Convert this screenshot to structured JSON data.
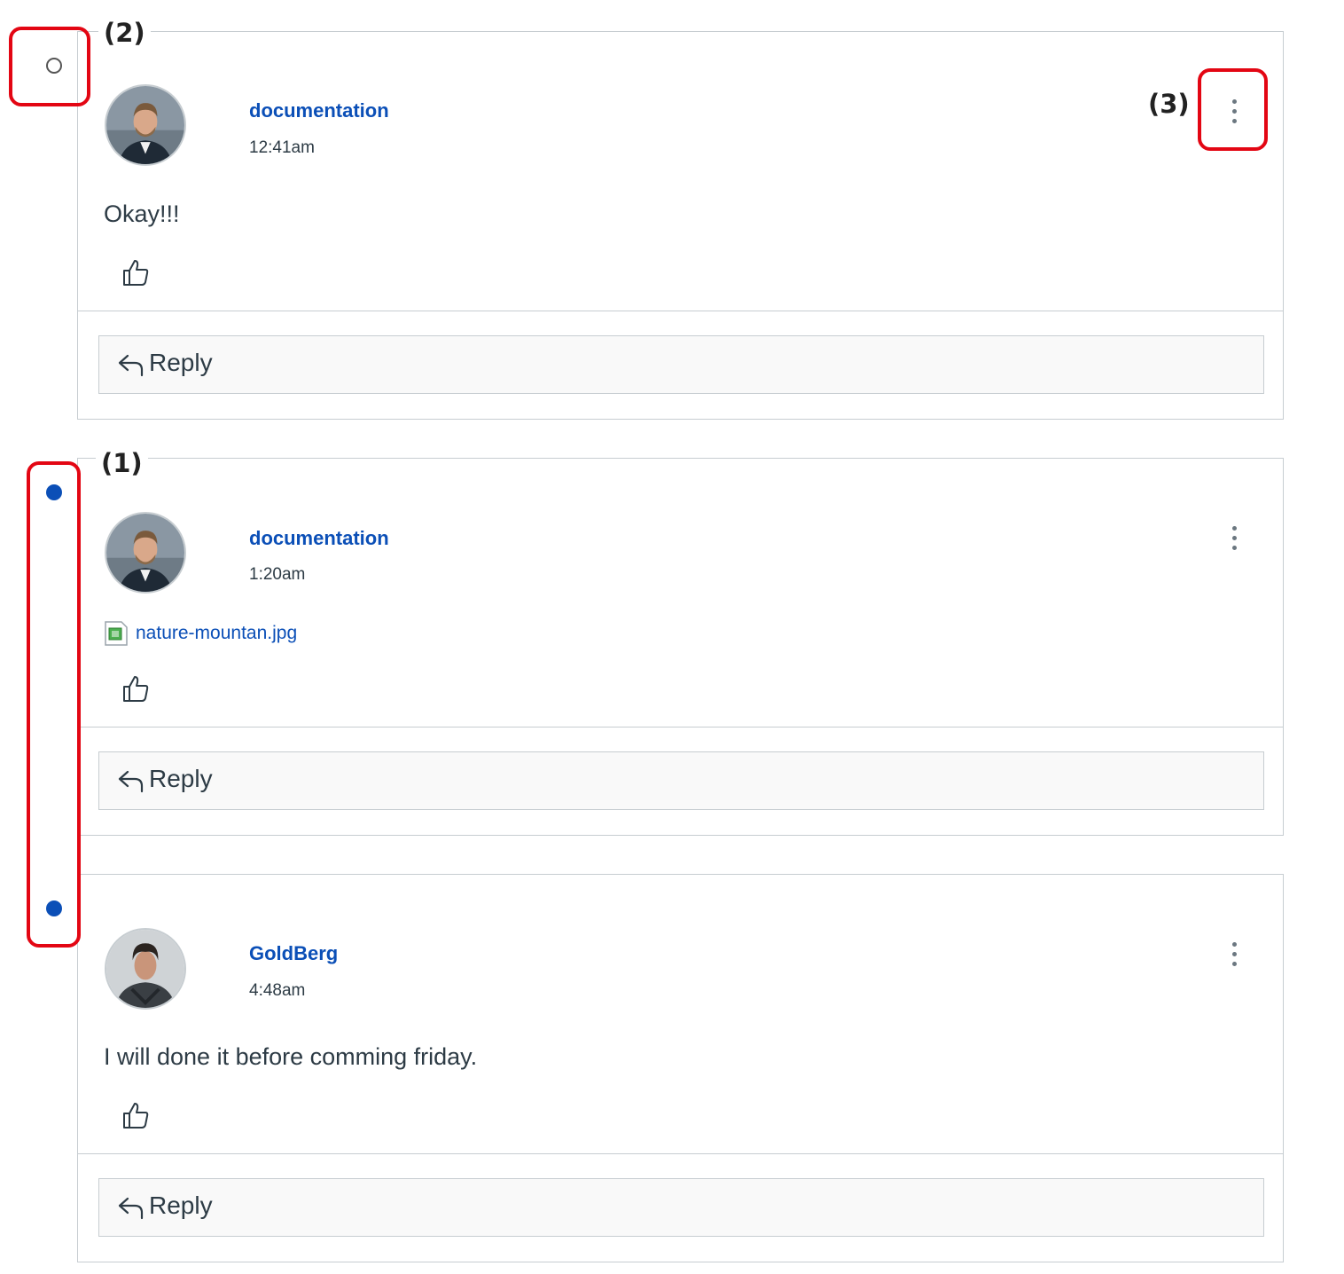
{
  "annotations": {
    "label_2": "(2)",
    "label_1": "(1)",
    "label_3": "(3)"
  },
  "posts": [
    {
      "author": "documentation",
      "time": "12:41am",
      "message": "Okay!!!",
      "reply_label": "Reply",
      "read_state": "read",
      "avatar": "man-blond-beard"
    },
    {
      "author": "documentation",
      "time": "1:20am",
      "attachment": "nature-mountan.jpg",
      "reply_label": "Reply",
      "read_state": "unread",
      "avatar": "man-blond-beard"
    },
    {
      "author": "GoldBerg",
      "time": "4:48am",
      "message": "I will done it before comming friday.",
      "reply_label": "Reply",
      "read_state": "unread",
      "avatar": "man-dark-hair"
    }
  ],
  "colors": {
    "link": "#0b4fb7",
    "unread_dot": "#0b4fb7",
    "annotation_box": "#e30613",
    "border": "#c7cdd1",
    "text": "#2d3b45"
  }
}
